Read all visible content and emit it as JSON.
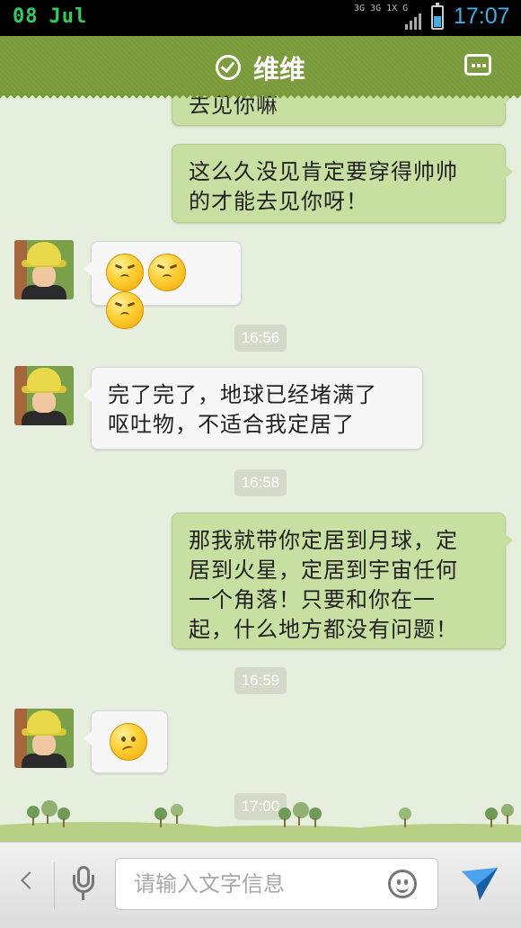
{
  "status_bar": {
    "date_day": "08",
    "date_month": "Jul",
    "network_top": "3G 3G 1X G",
    "time": "17:07",
    "battery_level": 0.55
  },
  "header": {
    "title": "维维",
    "status_icon": "check-circle-icon",
    "menu_icon": "more-icon"
  },
  "messages": [
    {
      "side": "right",
      "text": "去见你嘛"
    },
    {
      "side": "right",
      "line1": "这么久没见肯定要穿得帅帅",
      "line2": "的才能去见你呀！"
    },
    {
      "side": "left",
      "emoji": [
        "embarrassed-face-icon",
        "embarrassed-face-icon",
        "embarrassed-face-icon"
      ]
    },
    {
      "type": "time",
      "text": "16:56"
    },
    {
      "side": "left",
      "line1": "完了完了，地球已经堵满了",
      "line2": "呕吐物，不适合我定居了"
    },
    {
      "type": "time",
      "text": "16:58"
    },
    {
      "side": "right",
      "line1": "那我就带你定居到月球，定",
      "line2": "居到火星，定居到宇宙任何",
      "line3": "一个角落！只要和你在一",
      "line4": "起，什么地方都没有问题！"
    },
    {
      "type": "time",
      "text": "16:59"
    },
    {
      "side": "left",
      "emoji": [
        "thinking-face-icon"
      ]
    },
    {
      "type": "time",
      "text": "17:00"
    }
  ],
  "input_bar": {
    "placeholder": "请输入文字信息",
    "back_icon": "chevron-left-icon",
    "mic_icon": "microphone-icon",
    "emoji_icon": "smiley-icon",
    "send_icon": "send-plane-icon"
  },
  "colors": {
    "header_bg": "#7a9a3a",
    "chat_bg": "#e6eedd",
    "right_bubble": "#c7dfa0",
    "left_bubble": "#f7f7f7",
    "time_accent": "#3db0e8"
  }
}
